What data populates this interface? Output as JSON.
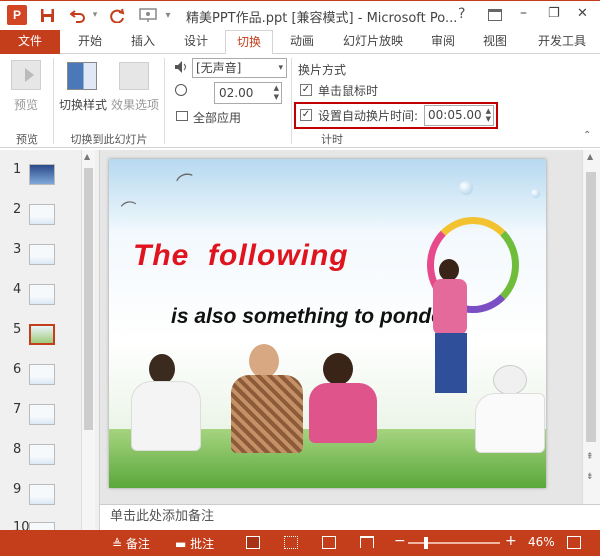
{
  "window": {
    "title": "精美PPT作品.ppt [兼容模式] - Microsoft Po...",
    "help": "?",
    "minimize": "–",
    "restore": "❐",
    "close": "✕"
  },
  "tabs": [
    "文件",
    "开始",
    "插入",
    "设计",
    "切换",
    "动画",
    "幻灯片放映",
    "审阅",
    "视图",
    "开发工具"
  ],
  "ribbon": {
    "preview_label": "预览",
    "switch_style_label": "切换样式",
    "effect_options_label": "效果选项",
    "sound_value": "[无声音]",
    "duration_value": "02.00",
    "apply_all_label": "全部应用",
    "advance_title": "换片方式",
    "on_click_label": "单击鼠标时",
    "auto_advance_label": "设置自动换片时间:",
    "auto_advance_value": "00:05.00",
    "group_preview": "预览",
    "group_switch": "切换到此幻灯片",
    "group_timing": "计时"
  },
  "thumbnails": [
    "1",
    "2",
    "3",
    "4",
    "5",
    "6",
    "7",
    "8",
    "9",
    "10"
  ],
  "slide": {
    "heading": "The  following",
    "subtext": "is also something to ponder..."
  },
  "notes_placeholder": "单击此处添加备注",
  "status": {
    "notes": "备注",
    "comments": "批注",
    "zoom": "46%"
  },
  "colors": {
    "accent": "#c43e1c",
    "highlight_border": "#c00000",
    "heading_red": "#e0141e"
  }
}
